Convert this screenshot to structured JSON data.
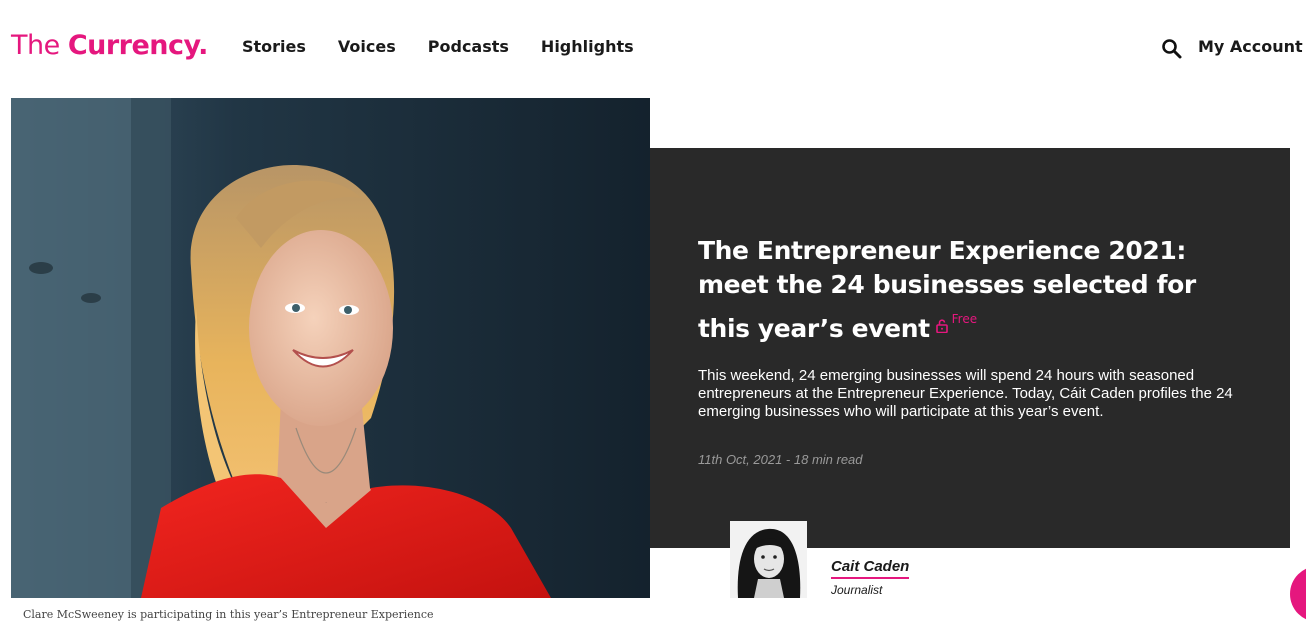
{
  "brand": {
    "logo_thin": "The ",
    "logo_bold": "Currency.",
    "accent_color": "#e5177e"
  },
  "nav": {
    "items": [
      {
        "label": "Stories"
      },
      {
        "label": "Voices"
      },
      {
        "label": "Podcasts"
      },
      {
        "label": "Highlights"
      }
    ],
    "search_icon": "search-icon",
    "account_label": "My Account"
  },
  "hero": {
    "image": "portrait-photo",
    "caption": "Clare McSweeney is participating in this year’s Entrepreneur Experience"
  },
  "article": {
    "headline": "The Entrepreneur Experience 2021: meet the 24 businesses selected for this year’s event",
    "badge_icon": "unlock-icon",
    "badge_label": "Free",
    "standfirst": "This weekend, 24 emerging businesses will spend 24 hours with seasoned entrepreneurs at the Entrepreneur Experience. Today, Cáit Caden profiles the 24 emerging businesses who will participate at this year’s event.",
    "meta": "11th Oct, 2021 - 18 min read",
    "panel_color": "#292929"
  },
  "author": {
    "photo": "author-photo",
    "name": "Cait Caden",
    "role": "Journalist"
  }
}
